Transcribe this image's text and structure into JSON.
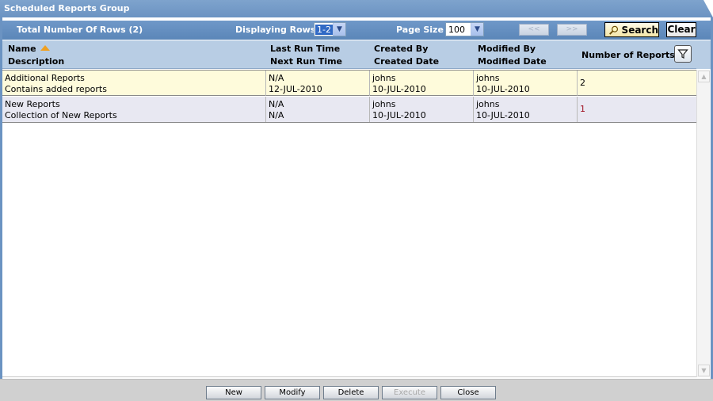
{
  "window": {
    "title": "Scheduled Reports Group"
  },
  "toolbar": {
    "total_rows_label": "Total Number Of Rows (2)",
    "displaying_rows_label": "Displaying Rows",
    "displaying_rows_value": "1-2",
    "page_size_label": "Page Size",
    "page_size_value": "100",
    "prev_label": "<<",
    "next_label": ">>",
    "search_label": "Search",
    "clear_label": "Clear"
  },
  "columns": {
    "name": "Name",
    "description": "Description",
    "last_run": "Last Run Time",
    "next_run": "Next Run Time",
    "created_by": "Created By",
    "created_date": "Created Date",
    "modified_by": "Modified By",
    "modified_date": "Modified Date",
    "num_reports": "Number of Reports"
  },
  "rows": [
    {
      "name": "Additional Reports",
      "description": "Contains added reports",
      "last_run": "N/A",
      "next_run": "12-JUL-2010",
      "created_by": "johns",
      "created_date": "10-JUL-2010",
      "modified_by": "johns",
      "modified_date": "10-JUL-2010",
      "num_reports": "2"
    },
    {
      "name": "New Reports",
      "description": "Collection of New Reports",
      "last_run": "N/A",
      "next_run": "N/A",
      "created_by": "johns",
      "created_date": "10-JUL-2010",
      "modified_by": "johns",
      "modified_date": "10-JUL-2010",
      "num_reports": "1"
    }
  ],
  "footer": {
    "new": "New",
    "modify": "Modify",
    "delete": "Delete",
    "execute": "Execute",
    "close": "Close"
  },
  "colors": {
    "header_blue": "#6b93c2",
    "grid_header": "#b8cde4",
    "row_selected": "#fefbdb",
    "row_alt": "#e8e8f2"
  }
}
